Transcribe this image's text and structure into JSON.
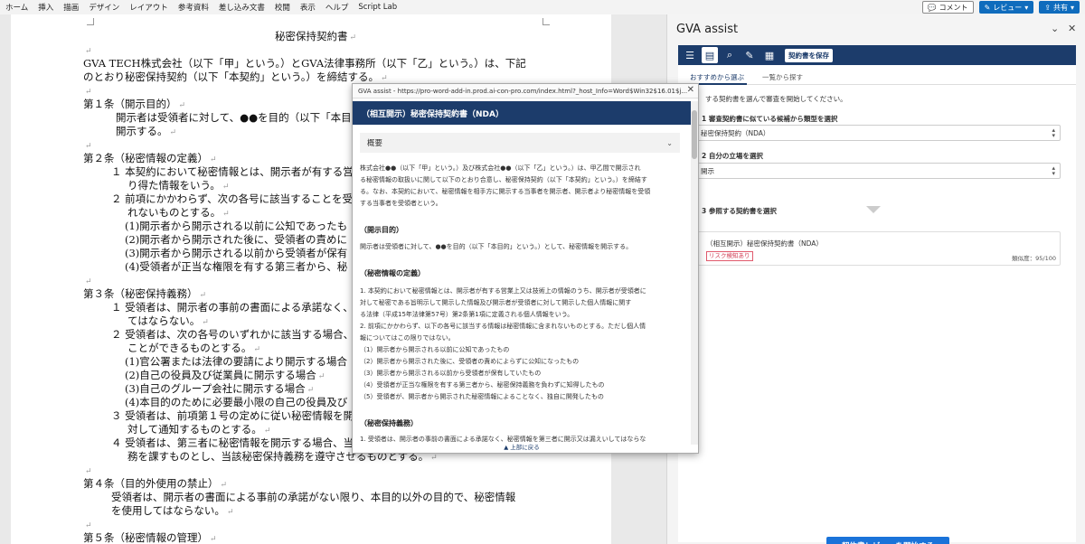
{
  "ribbon": {
    "menu": [
      "ホーム",
      "挿入",
      "描画",
      "デザイン",
      "レイアウト",
      "参考資料",
      "差し込み文書",
      "校閲",
      "表示",
      "ヘルプ",
      "Script Lab"
    ],
    "comment_label": "コメント",
    "review_label": "レビュー",
    "share_label": "共有"
  },
  "document": {
    "lines": [
      "秘密保持契約書",
      "GVA TECH株式会社（以下「甲」という。）とGVA法律事務所（以下「乙」という。）は、下記",
      "のとおり秘密保持契約（以下「本契約」という。）を締結する。",
      "第１条（開示目的）",
      "開示者は受領者に対して、●●を目的（以下「本目",
      "開示する。",
      "第２条（秘密情報の定義）",
      "１ 本契約において秘密情報とは、開示者が有する営",
      "り得た情報をいう。",
      "２ 前項にかかわらず、次の各号に該当することを受",
      "れないものとする。",
      "(1)開示者から開示される以前に公知であったも",
      "(2)開示者から開示された後に、受領者の責めに",
      "(3)開示者から開示される以前から受領者が保有",
      "(4)受領者が正当な権限を有する第三者から、秘",
      "第３条（秘密保持義務）",
      "１ 受領者は、開示者の事前の書面による承諾なく、",
      "てはならない。",
      "２ 受領者は、次の各号のいずれかに該当する場合、",
      "ことができるものとする。",
      "(1)官公署または法律の要請により開示する場合",
      "(2)自己の役員及び従業員に開示する場合",
      "(3)自己のグループ会社に開示する場合",
      "(4)本目的のために必要最小限の自己の役員及び",
      "３ 受領者は、前項第１号の定めに従い秘密情報を開",
      "対して通知するものとする。",
      "４ 受領者は、第三者に秘密情報を開示する場合、当",
      "務を課すものとし、当該秘密保持義務を遵守させるものとする。",
      "第４条（目的外使用の禁止）",
      "受領者は、開示者の書面による事前の承諾がない限り、本目的以外の目的で、秘密情報",
      "を使用してはならない。",
      "第５条（秘密情報の管理）"
    ]
  },
  "pane": {
    "title": "GVA assist",
    "save_label": "契約書を保存",
    "tabs": [
      "おすすめから選ぶ",
      "一覧から探す"
    ],
    "intro": "する契約書を選んで審査を開始してください。",
    "step1_label": "1 審査契約書に似ている候補から類型を選択",
    "step1_value": "秘密保持契約（NDA）",
    "step2_label": "2 自分の立場を選択",
    "step2_value": "開示",
    "step3_label": "3 参照する契約書を選択",
    "contract_title": "（相互開示）秘密保持契約書（NDA）",
    "risk_badge": "リスク検知あり",
    "similarity": "類似度：95/100",
    "start_button": "契約書レビューを開始する"
  },
  "modal": {
    "url": "GVA assist - https://pro-word-add-in.prod.ai-con-pro.com/index.html?_host_Info=Word$Win32$16.01$j...",
    "header": "（相互開示）秘密保持契約書（NDA）",
    "overview_label": "概要",
    "intro_lines": [
      "株式会社●●（以下「甲」という。）及び株式会社●●（以下「乙」という。）は、甲乙間で開示され",
      "る秘密情報の取扱いに関して以下のとおり合意し、秘密保持契約（以下「本契約」という。）を締結す",
      "る。なお、本契約において、秘密情報を相手方に開示する当事者を開示者、開示者より秘密情報を受領",
      "する当事者を受領者という。"
    ],
    "sec1_title": "（開示目的）",
    "sec1_text": "開示者は受領者に対して、●●を目的（以下「本目的」という。）として、秘密情報を開示する。",
    "sec2_title": "（秘密情報の定義）",
    "sec2_lines": [
      "1. 本契約において秘密情報とは、開示者が有する営業上又は技術上の情報のうち、開示者が受領者に",
      "対して秘密である旨明示して開示した情報及び開示者が受領者に対して開示した個人情報に関す",
      "る法律（平成15年法律第57号）第2条第1項に定義される個人情報をいう。",
      "2. 前項にかかわらず、以下の各号に該当する情報は秘密情報に含まれないものとする。ただし個人情",
      "報についてはこの限りではない。",
      "（1）開示者から開示される以前に公知であったもの",
      "（2）開示者から開示された後に、受領者の責めによらずに公知になったもの",
      "（3）開示者から開示される以前から受領者が保有していたもの",
      "（4）受領者が正当な権限を有する第三者から、秘密保持義務を負わずに知得したもの",
      "（5）受領者が、開示者から開示された秘密情報によることなく、独自に開発したもの"
    ],
    "sec3_title": "（秘密保持義務）",
    "sec3_text": "1. 受領者は、開示者の事前の書面による承諾なく、秘密情報を第三者に開示又は漏えいしてはならな",
    "back_to_top": "▲ 上部に戻る"
  }
}
